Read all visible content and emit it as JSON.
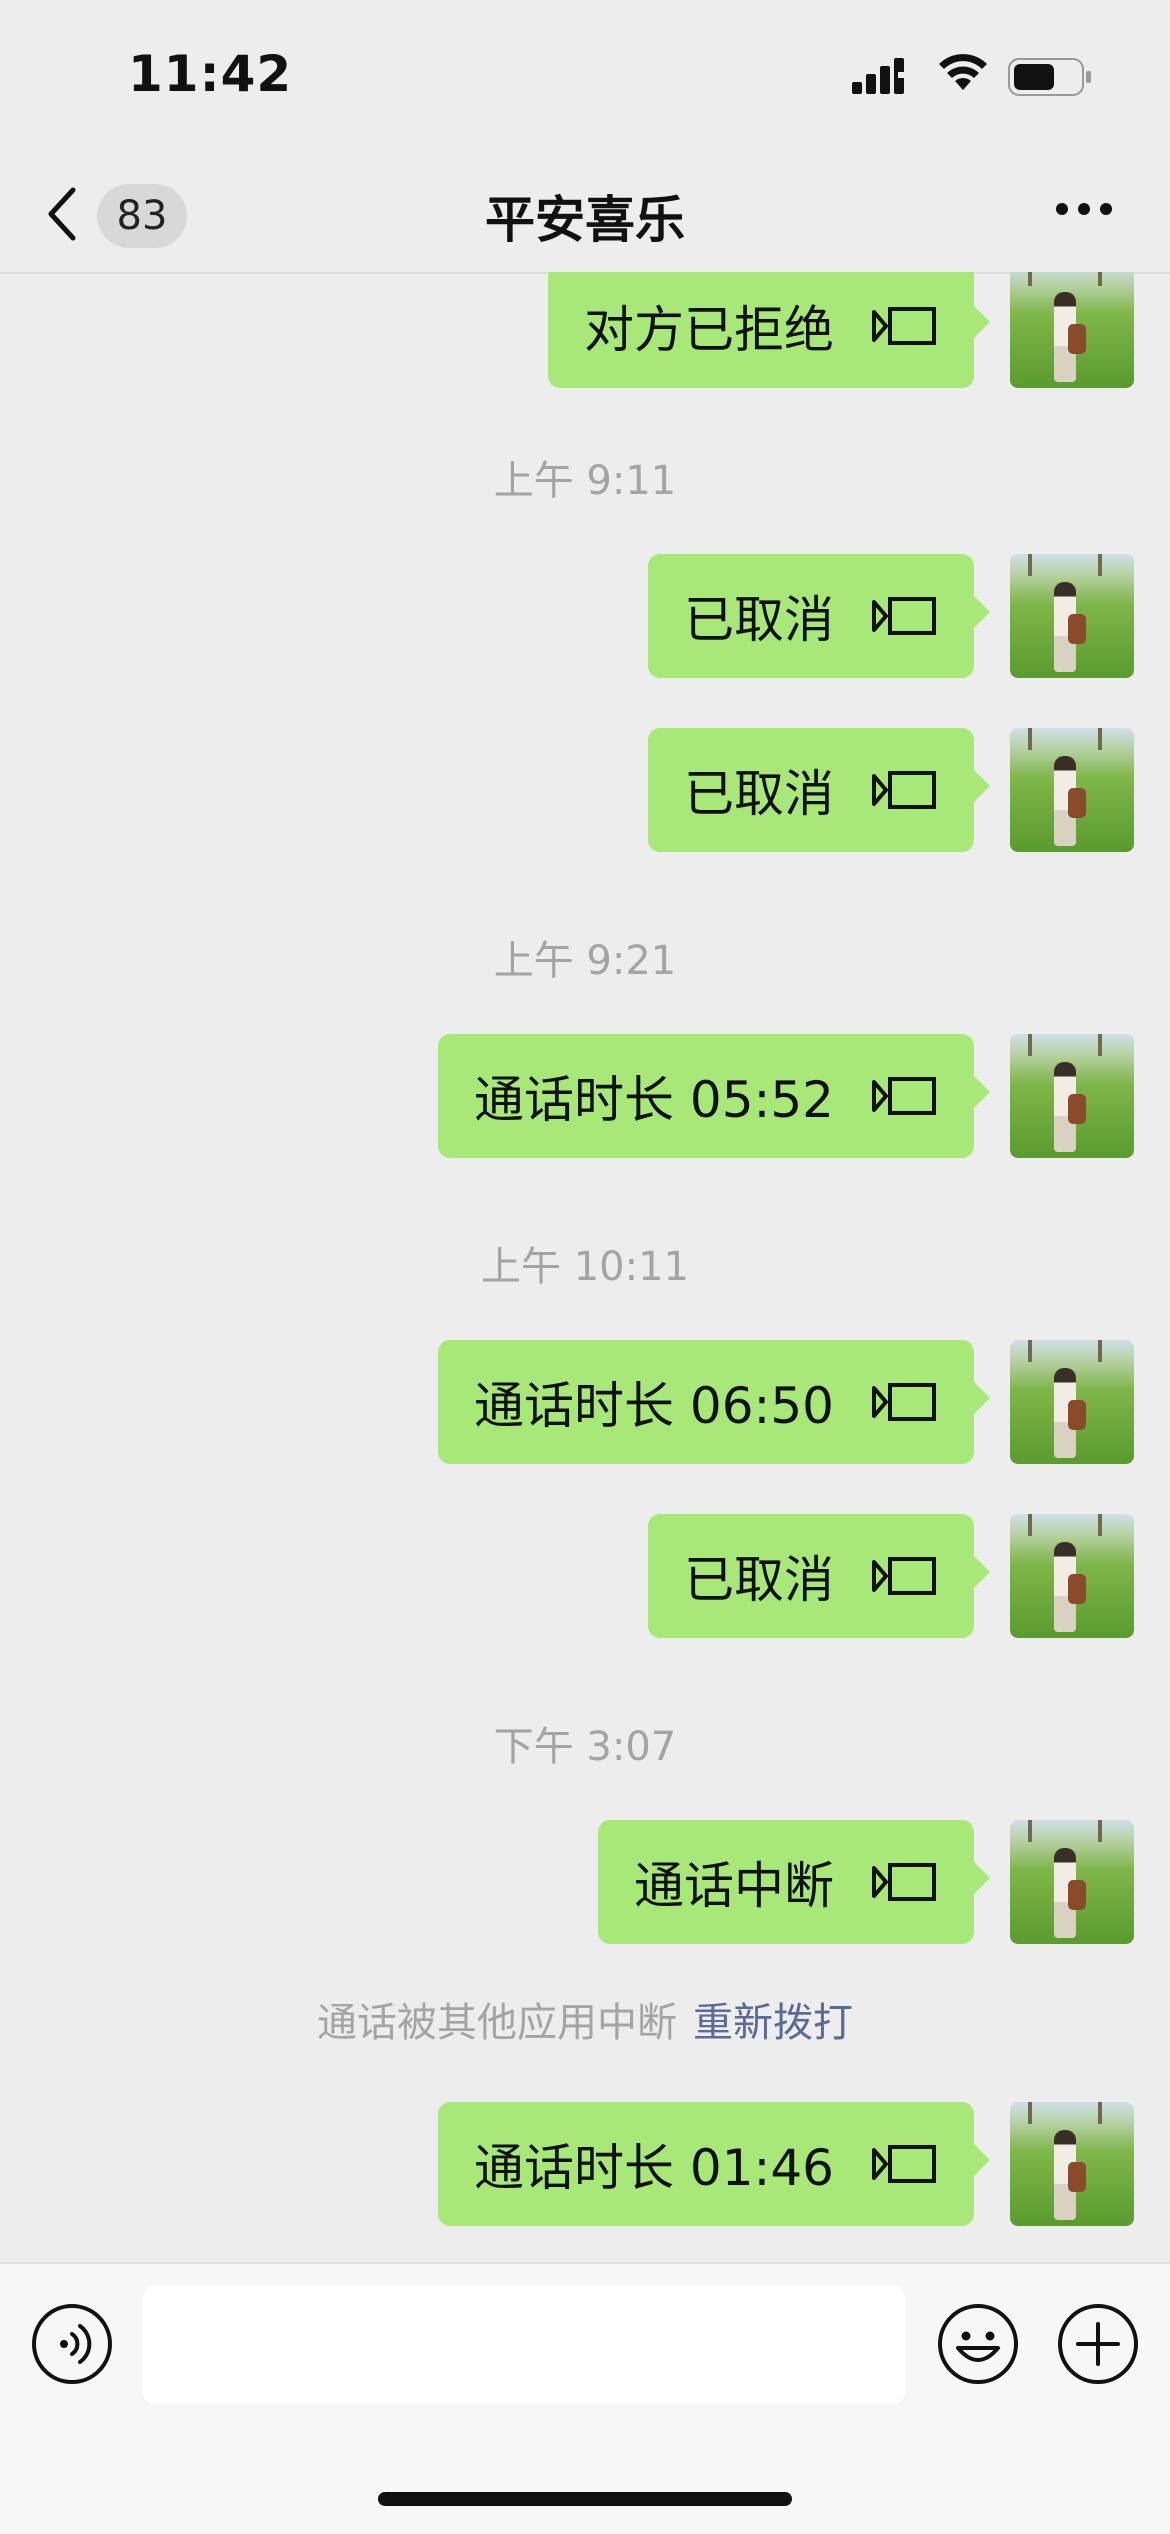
{
  "status_bar": {
    "time": "11:42"
  },
  "nav": {
    "back_badge": "83",
    "title": "平安喜乐"
  },
  "icons": {
    "back": "chevron-left-icon",
    "more": "ellipsis-icon",
    "call": "video-call-icon",
    "voice": "voice-input-icon",
    "emoji": "emoji-icon",
    "plus": "plus-icon"
  },
  "colors": {
    "bubble_self": "#a8e879",
    "background": "#ededed",
    "link": "#5b6b95",
    "timestamp": "#a4a4a4"
  },
  "messages": [
    {
      "text": "对方已拒绝"
    },
    {
      "timestamp": "上午 9:11"
    },
    {
      "text": "已取消"
    },
    {
      "text": "已取消"
    },
    {
      "timestamp": "上午 9:21"
    },
    {
      "text": "通话时长 05:52"
    },
    {
      "timestamp": "上午 10:11"
    },
    {
      "text": "通话时长 06:50"
    },
    {
      "text": "已取消"
    },
    {
      "timestamp": "下午 3:07"
    },
    {
      "text": "通话中断"
    },
    {
      "system": "通话被其他应用中断",
      "link": "重新拨打"
    },
    {
      "text": "通话时长 01:46"
    }
  ],
  "input": {
    "placeholder": ""
  }
}
